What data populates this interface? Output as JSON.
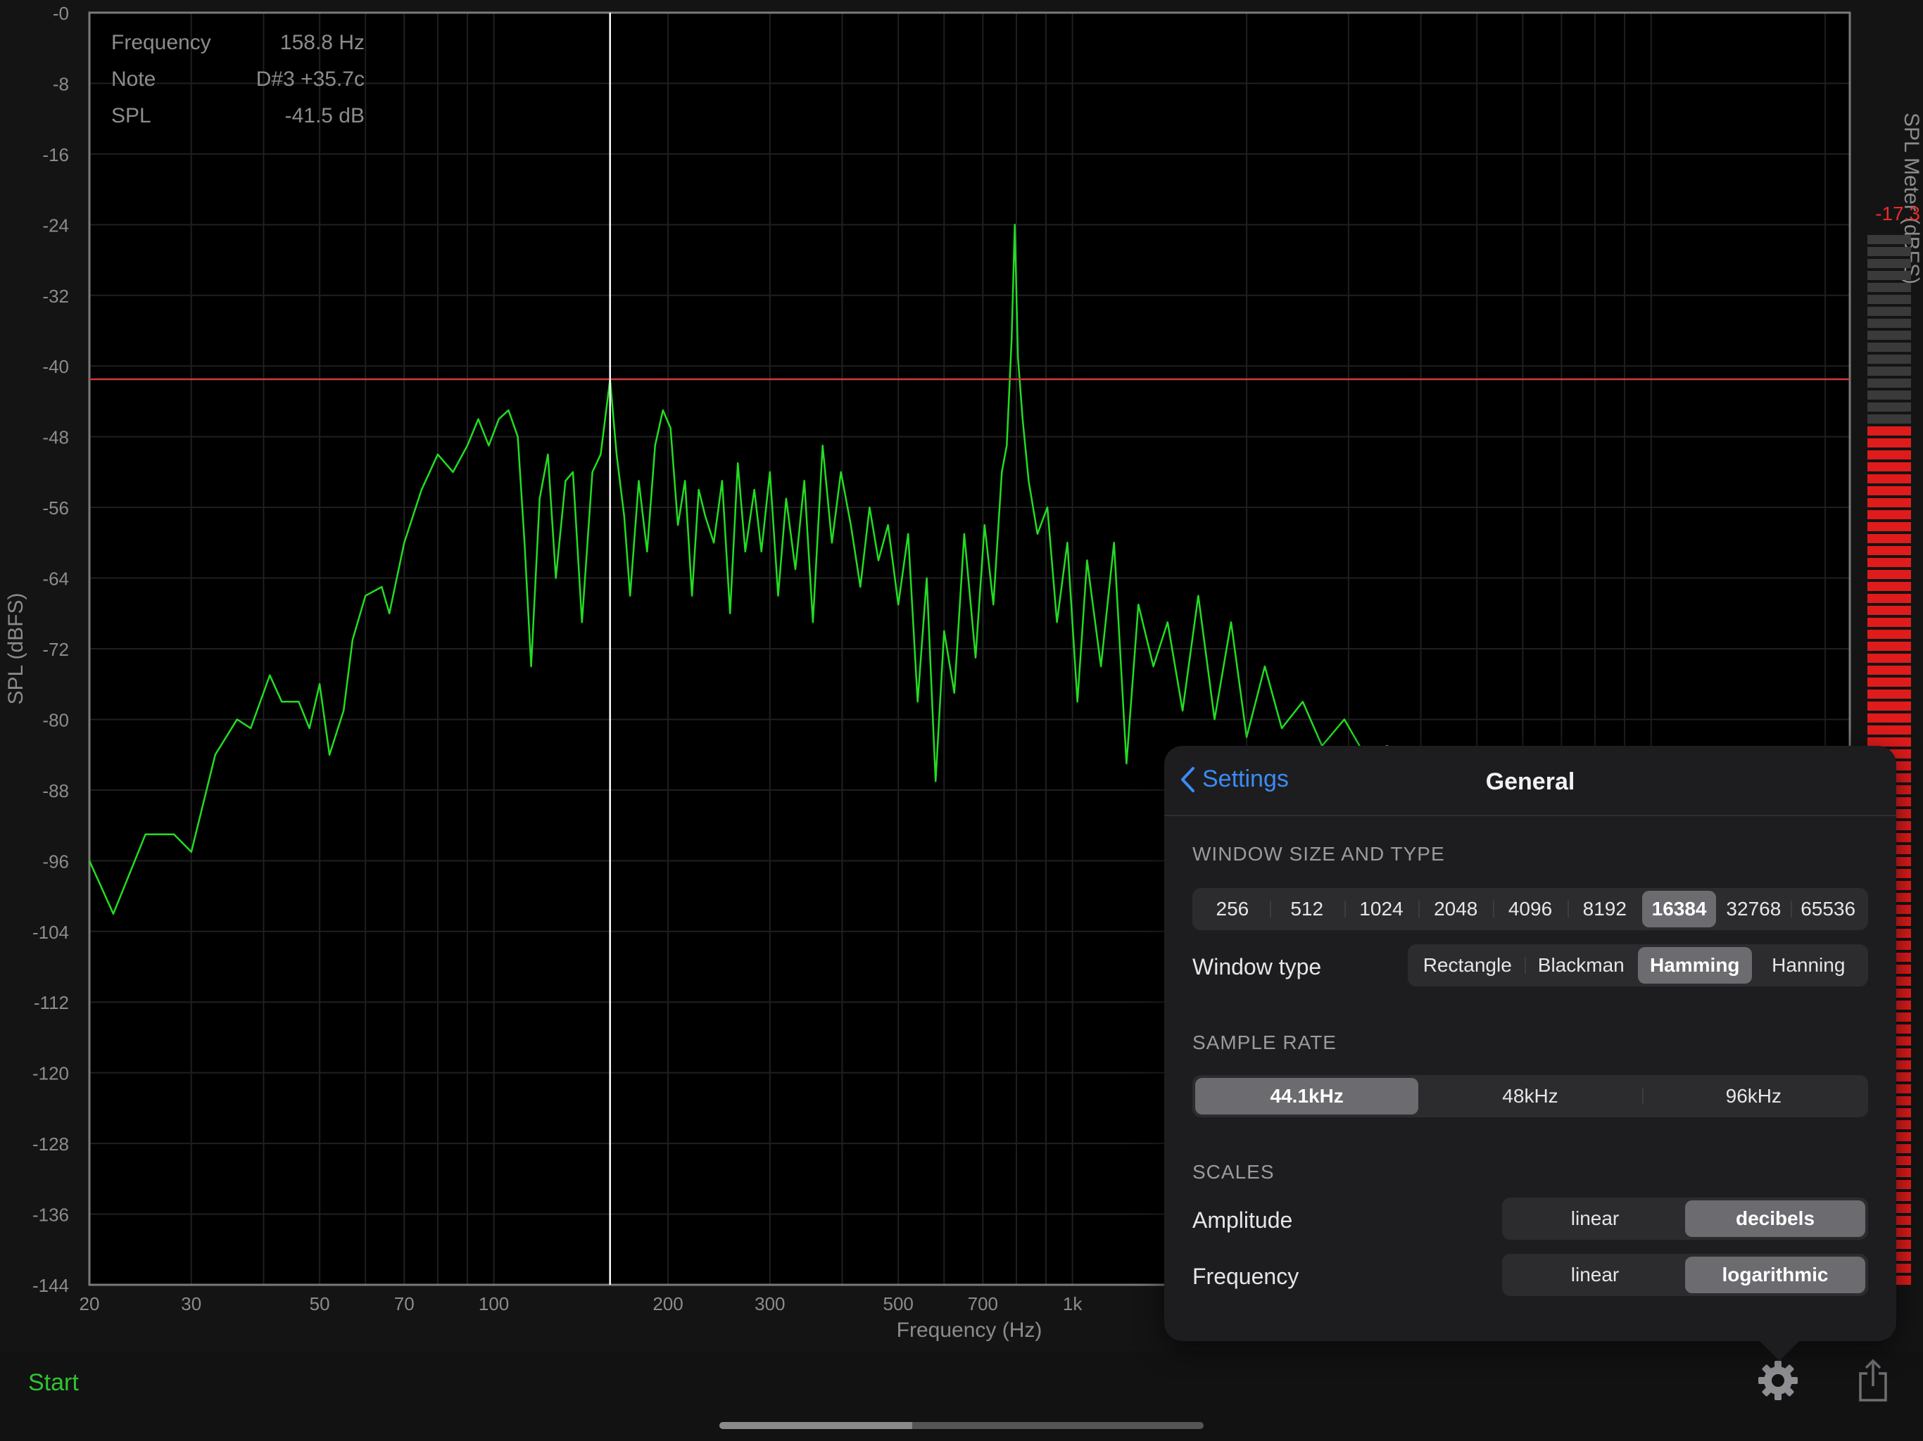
{
  "chart_data": {
    "type": "line",
    "xlabel": "Frequency (Hz)",
    "ylabel": "SPL (dBFS)",
    "xscale": "log",
    "xlim": [
      20,
      22050
    ],
    "ylim": [
      -144,
      0
    ],
    "y_tick_labels": [
      "-0",
      "-8",
      "-16",
      "-24",
      "-32",
      "-40",
      "-48",
      "-56",
      "-64",
      "-72",
      "-80",
      "-88",
      "-96",
      "-104",
      "-112",
      "-120",
      "-128",
      "-136",
      "-144"
    ],
    "x_ticks": [
      {
        "value": 20,
        "label": "20"
      },
      {
        "value": 30,
        "label": "30"
      },
      {
        "value": 50,
        "label": "50"
      },
      {
        "value": 70,
        "label": "70"
      },
      {
        "value": 100,
        "label": "100"
      },
      {
        "value": 200,
        "label": "200"
      },
      {
        "value": 300,
        "label": "300"
      },
      {
        "value": 500,
        "label": "500"
      },
      {
        "value": 700,
        "label": "700"
      },
      {
        "value": 1000,
        "label": "1k"
      }
    ],
    "grid": true,
    "cursor": {
      "frequency": 158.8,
      "level": -41.5
    },
    "series": [
      {
        "color": "#22dd22",
        "points": [
          [
            20,
            -96
          ],
          [
            22,
            -102
          ],
          [
            25,
            -93
          ],
          [
            28,
            -93
          ],
          [
            30,
            -95
          ],
          [
            33,
            -84
          ],
          [
            36,
            -80
          ],
          [
            38,
            -81
          ],
          [
            41,
            -75
          ],
          [
            43,
            -78
          ],
          [
            46,
            -78
          ],
          [
            48,
            -81
          ],
          [
            50,
            -76
          ],
          [
            52,
            -84
          ],
          [
            55,
            -79
          ],
          [
            57,
            -71
          ],
          [
            60,
            -66
          ],
          [
            64,
            -65
          ],
          [
            66,
            -68
          ],
          [
            70,
            -60
          ],
          [
            75,
            -54
          ],
          [
            80,
            -50
          ],
          [
            85,
            -52
          ],
          [
            90,
            -49
          ],
          [
            94,
            -46
          ],
          [
            98,
            -49
          ],
          [
            102,
            -46
          ],
          [
            106,
            -45
          ],
          [
            110,
            -48
          ],
          [
            113,
            -60
          ],
          [
            116,
            -74
          ],
          [
            120,
            -55
          ],
          [
            124,
            -50
          ],
          [
            128,
            -64
          ],
          [
            133,
            -53
          ],
          [
            137,
            -52
          ],
          [
            142,
            -69
          ],
          [
            148,
            -52
          ],
          [
            153,
            -50
          ],
          [
            158.8,
            -41.5
          ],
          [
            163,
            -50
          ],
          [
            168,
            -57
          ],
          [
            172,
            -66
          ],
          [
            178,
            -53
          ],
          [
            184,
            -61
          ],
          [
            190,
            -49
          ],
          [
            196,
            -45
          ],
          [
            202,
            -47
          ],
          [
            208,
            -58
          ],
          [
            214,
            -53
          ],
          [
            220,
            -66
          ],
          [
            226,
            -54
          ],
          [
            232,
            -57
          ],
          [
            240,
            -60
          ],
          [
            248,
            -53
          ],
          [
            256,
            -68
          ],
          [
            264,
            -51
          ],
          [
            272,
            -61
          ],
          [
            282,
            -54
          ],
          [
            290,
            -61
          ],
          [
            300,
            -52
          ],
          [
            310,
            -66
          ],
          [
            320,
            -55
          ],
          [
            332,
            -63
          ],
          [
            344,
            -53
          ],
          [
            356,
            -69
          ],
          [
            370,
            -49
          ],
          [
            384,
            -60
          ],
          [
            398,
            -52
          ],
          [
            414,
            -58
          ],
          [
            430,
            -65
          ],
          [
            446,
            -56
          ],
          [
            462,
            -62
          ],
          [
            480,
            -58
          ],
          [
            500,
            -67
          ],
          [
            520,
            -59
          ],
          [
            540,
            -78
          ],
          [
            560,
            -64
          ],
          [
            580,
            -87
          ],
          [
            600,
            -70
          ],
          [
            625,
            -77
          ],
          [
            650,
            -59
          ],
          [
            680,
            -73
          ],
          [
            705,
            -58
          ],
          [
            730,
            -67
          ],
          [
            755,
            -52
          ],
          [
            770,
            -49
          ],
          [
            785,
            -37
          ],
          [
            795,
            -24
          ],
          [
            805,
            -39
          ],
          [
            820,
            -46
          ],
          [
            840,
            -53
          ],
          [
            870,
            -59
          ],
          [
            905,
            -56
          ],
          [
            940,
            -69
          ],
          [
            980,
            -60
          ],
          [
            1020,
            -78
          ],
          [
            1060,
            -62
          ],
          [
            1120,
            -74
          ],
          [
            1180,
            -60
          ],
          [
            1240,
            -85
          ],
          [
            1300,
            -67
          ],
          [
            1380,
            -74
          ],
          [
            1460,
            -69
          ],
          [
            1550,
            -79
          ],
          [
            1650,
            -66
          ],
          [
            1760,
            -80
          ],
          [
            1880,
            -69
          ],
          [
            2000,
            -82
          ],
          [
            2150,
            -74
          ],
          [
            2300,
            -81
          ],
          [
            2500,
            -78
          ],
          [
            2700,
            -83
          ],
          [
            2950,
            -80
          ],
          [
            3200,
            -84
          ],
          [
            3500,
            -83
          ],
          [
            3850,
            -85
          ],
          [
            4200,
            -84
          ]
        ]
      }
    ]
  },
  "readout": {
    "rows": [
      {
        "label": "Frequency",
        "value": "158.8 Hz"
      },
      {
        "label": "Note",
        "value": "D#3 +35.7c"
      },
      {
        "label": "SPL",
        "value": "-41.5 dB"
      }
    ]
  },
  "meter": {
    "title": "SPL Meter (dBFS)",
    "value": "-17.3",
    "level": -17.3,
    "colors": {
      "active": "#e01b1b",
      "inactive": "#3a3a3a",
      "value": "#e82b2b"
    }
  },
  "popover": {
    "back_label": "Settings",
    "title": "General",
    "window_section": "WINDOW SIZE AND TYPE",
    "window_sizes": [
      "256",
      "512",
      "1024",
      "2048",
      "4096",
      "8192",
      "16384",
      "32768",
      "65536"
    ],
    "window_size_selected": "16384",
    "window_type_label": "Window type",
    "window_types": [
      "Rectangle",
      "Blackman",
      "Hamming",
      "Hanning"
    ],
    "window_type_selected": "Hamming",
    "sample_rate_section": "SAMPLE RATE",
    "sample_rates": [
      "44.1kHz",
      "48kHz",
      "96kHz"
    ],
    "sample_rate_selected": "44.1kHz",
    "scales_section": "SCALES",
    "amplitude_label": "Amplitude",
    "amplitude_options": [
      "linear",
      "decibels"
    ],
    "amplitude_selected": "decibels",
    "frequency_label": "Frequency",
    "frequency_options": [
      "linear",
      "logarithmic"
    ],
    "frequency_selected": "logarithmic"
  },
  "toolbar": {
    "start_label": "Start",
    "settings_icon": "gear-icon",
    "share_icon": "share-icon"
  },
  "colors": {
    "accent": "#3b8cf5",
    "trace": "#22dd22",
    "cursor_level": "#d23a3a",
    "start": "#2fc42f"
  }
}
